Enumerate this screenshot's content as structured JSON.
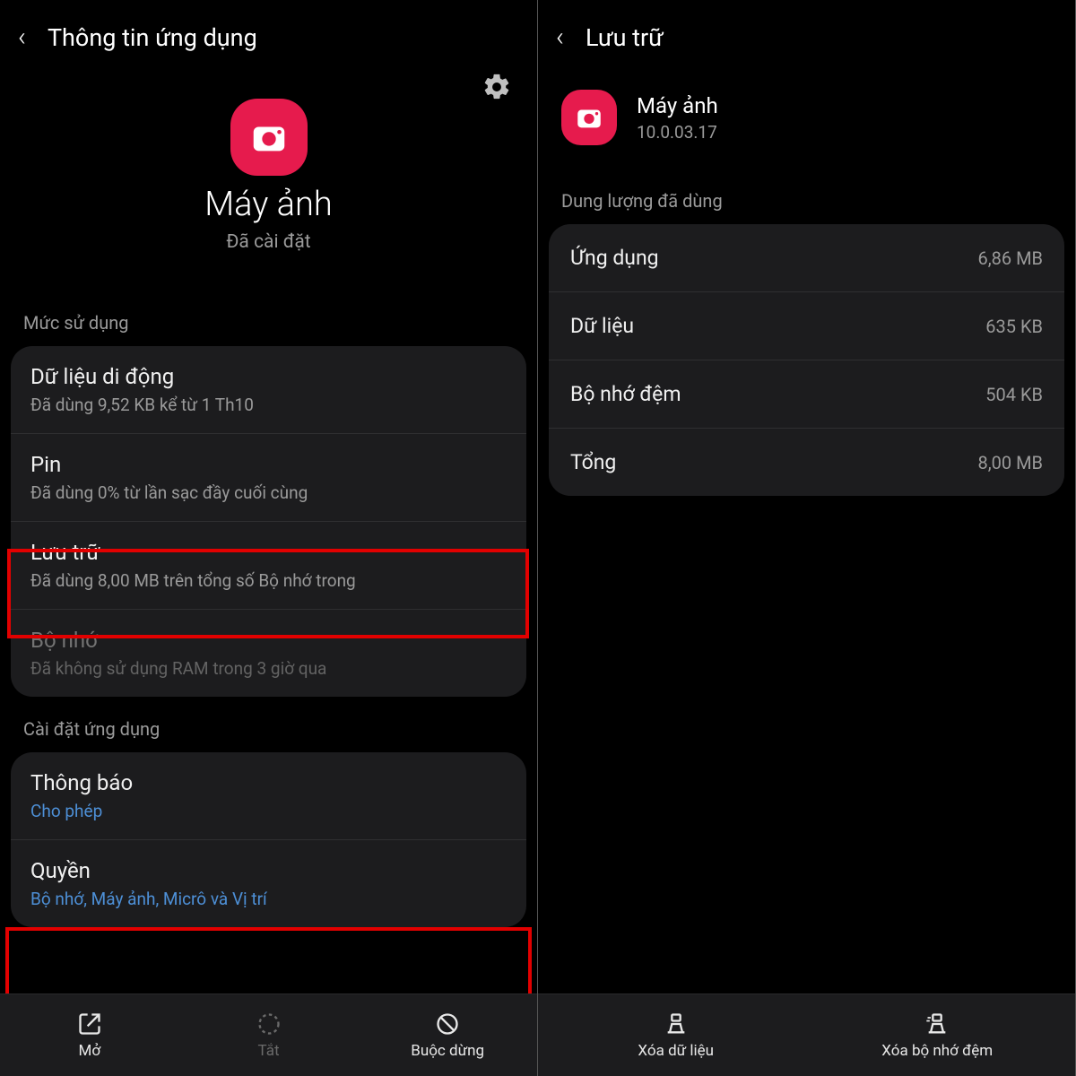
{
  "left": {
    "title": "Thông tin ứng dụng",
    "app_name": "Máy ảnh",
    "app_status": "Đã cài đặt",
    "sect_usage": "Mức sử dụng",
    "rows": {
      "mobile_data": {
        "title": "Dữ liệu di động",
        "sub": "Đã dùng 9,52 KB kể từ 1 Th10"
      },
      "battery": {
        "title": "Pin",
        "sub": "Đã dùng 0% từ lần sạc đầy cuối cùng"
      },
      "storage": {
        "title": "Lưu trữ",
        "sub": "Đã dùng 8,00 MB trên tổng số Bộ nhớ trong"
      },
      "memory": {
        "title": "Bộ nhớ",
        "sub": "Đã không sử dụng RAM trong 3 giờ qua"
      }
    },
    "sect_app_settings": "Cài đặt ứng dụng",
    "notif": {
      "title": "Thông báo",
      "sub": "Cho phép"
    },
    "perm": {
      "title": "Quyền",
      "sub": "Bộ nhớ, Máy ảnh, Micrô và Vị trí"
    },
    "bottom": {
      "open": "Mở",
      "disable": "Tắt",
      "force_stop": "Buộc dừng"
    }
  },
  "right": {
    "title": "Lưu trữ",
    "app_name": "Máy ảnh",
    "version": "10.0.03.17",
    "sect_used": "Dung lượng đã dùng",
    "kv": {
      "app": {
        "k": "Ứng dụng",
        "v": "6,86 MB"
      },
      "data": {
        "k": "Dữ liệu",
        "v": "635 KB"
      },
      "cache": {
        "k": "Bộ nhớ đệm",
        "v": "504 KB"
      },
      "total": {
        "k": "Tổng",
        "v": "8,00 MB"
      }
    },
    "bottom": {
      "clear_data": "Xóa dữ liệu",
      "clear_cache": "Xóa bộ nhớ đệm"
    }
  }
}
